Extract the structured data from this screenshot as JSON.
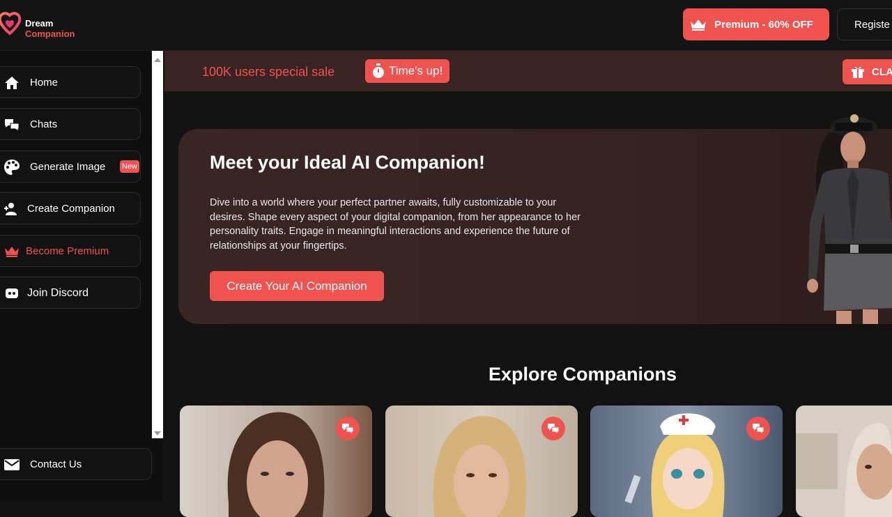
{
  "header": {
    "logo_line1": "Dream",
    "logo_line2": "Companion",
    "premium_label": "Premium - 60% OFF",
    "register_label": "Registe"
  },
  "sidebar": {
    "items": [
      {
        "label": "Home",
        "icon": "home-icon"
      },
      {
        "label": "Chats",
        "icon": "chats-icon"
      },
      {
        "label": "Generate Image",
        "icon": "palette-icon",
        "badge": "New"
      },
      {
        "label": "Create Companion",
        "icon": "add-user-icon"
      },
      {
        "label": "Become Premium",
        "icon": "crown-icon"
      },
      {
        "label": "Join Discord",
        "icon": "discord-icon"
      }
    ],
    "contact_label": "Contact Us"
  },
  "sale": {
    "text": "100K users special sale",
    "timer_label": "Time's up!",
    "claim_label": "CLA"
  },
  "hero": {
    "title": "Meet your Ideal AI Companion!",
    "description": "Dive into a world where your perfect partner awaits, fully customizable to your desires. Shape every aspect of your digital companion, from her appearance to her personality traits. Engage in meaningful interactions and experience the future of relationships at your fingertips.",
    "button_label": "Create Your AI Companion"
  },
  "explore": {
    "title": "Explore Companions"
  },
  "colors": {
    "accent": "#ef5350",
    "background": "#121212",
    "hero_bg": "#3a2525",
    "sale_bar": "#3a2423"
  }
}
